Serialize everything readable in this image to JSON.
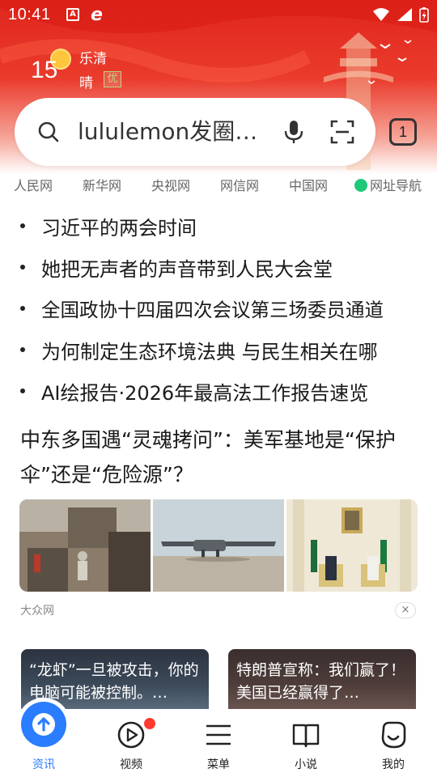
{
  "status_bar": {
    "time": "10:41",
    "battery_icon": "battery-charging-icon",
    "signal_icon": "cell-signal-icon",
    "wifi_icon": "wifi-icon"
  },
  "weather": {
    "temperature": "15",
    "location": "乐清",
    "condition": "晴",
    "aqi": "优"
  },
  "search": {
    "query": "lululemon发圈…",
    "tabs_count": "1"
  },
  "quick_links": [
    "人民网",
    "新华网",
    "央视网",
    "网信网",
    "中国网",
    "网址导航"
  ],
  "hot_list": [
    "习近平的两会时间",
    "她把无声者的声音带到人民大会堂",
    "全国政协十四届四次会议第三场委员通道",
    "为何制定生态环境法典 与民生相关在哪",
    "AI绘报告·2026年最高法工作报告速览"
  ],
  "article": {
    "title": "中东多国遇“灵魂拷问”：美军基地是“保护伞”还是“危险源”？",
    "source": "大众网",
    "dismiss": "×"
  },
  "cards": [
    {
      "text": "“龙虾”一旦被攻击，你的电脑可能被控制。…"
    },
    {
      "text": "特朗普宣称：我们赢了！美国已经赢得了…"
    }
  ],
  "bottom_nav": [
    {
      "label": "资讯",
      "icon": "upload-arrow-icon",
      "active": true
    },
    {
      "label": "视频",
      "icon": "play-circle-icon",
      "active": false
    },
    {
      "label": "菜单",
      "icon": "menu-icon",
      "active": false
    },
    {
      "label": "小说",
      "icon": "book-icon",
      "active": false
    },
    {
      "label": "我的",
      "icon": "smiley-face-icon",
      "active": false
    }
  ],
  "colors": {
    "header_red": "#e0261d",
    "accent_blue": "#2a7dff",
    "notification_red": "#ff3b30",
    "nav_green": "#1ec97a"
  }
}
